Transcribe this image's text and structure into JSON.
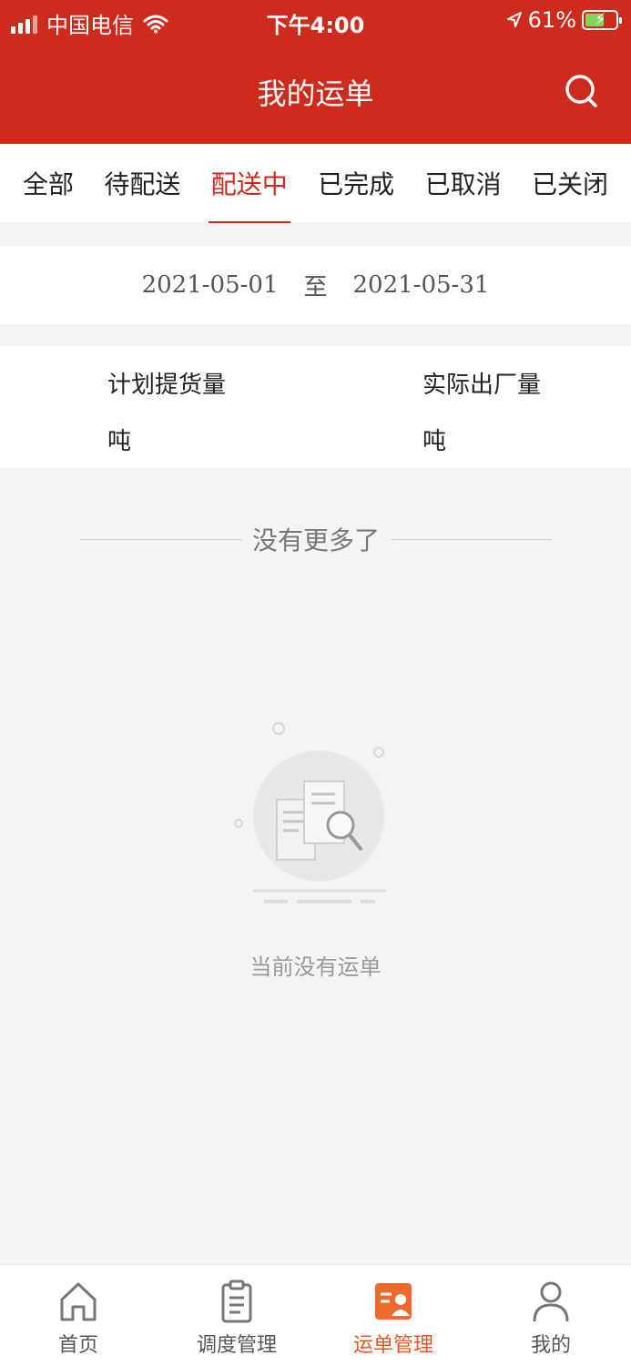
{
  "status_bar": {
    "carrier": "中国电信",
    "time": "下午4:00",
    "battery": "61%",
    "battery_level": 0.61,
    "accent": "#cc2b1d"
  },
  "header": {
    "title": "我的运单",
    "search_icon": "search-icon"
  },
  "tabs": [
    {
      "label": "全部",
      "active": false
    },
    {
      "label": "待配送",
      "active": false
    },
    {
      "label": "配送中",
      "active": true
    },
    {
      "label": "已完成",
      "active": false
    },
    {
      "label": "已取消",
      "active": false
    },
    {
      "label": "已关闭",
      "active": false
    }
  ],
  "date_range": {
    "start": "2021-05-01",
    "separator": "至",
    "end": "2021-05-31"
  },
  "summary": {
    "planned_label": "计划提货量",
    "planned_unit": "吨",
    "actual_label": "实际出厂量",
    "actual_unit": "吨"
  },
  "list": {
    "no_more": "没有更多了",
    "empty_text": "当前没有运单"
  },
  "bottom_nav": [
    {
      "label": "首页",
      "icon": "home-icon",
      "active": false
    },
    {
      "label": "调度管理",
      "icon": "clipboard-icon",
      "active": false
    },
    {
      "label": "运单管理",
      "icon": "waybill-icon",
      "active": true
    },
    {
      "label": "我的",
      "icon": "user-icon",
      "active": false
    }
  ]
}
